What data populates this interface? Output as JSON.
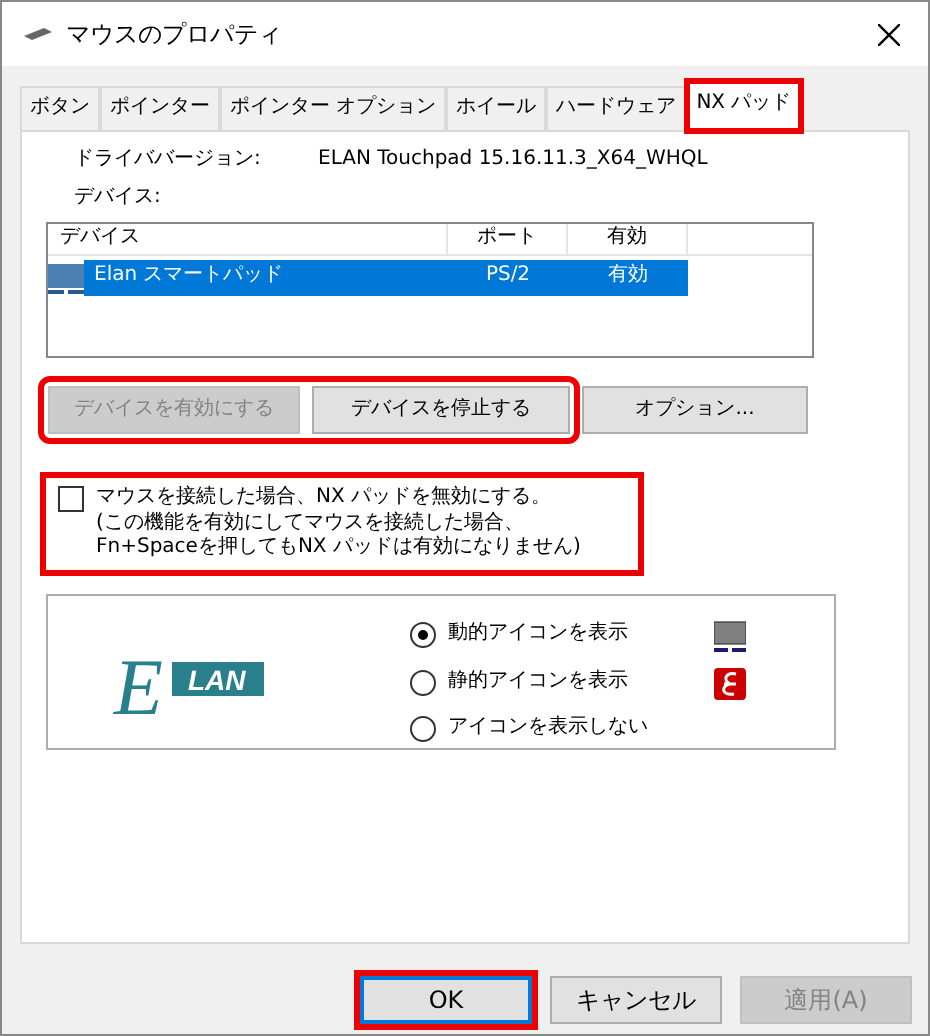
{
  "window": {
    "title": "マウスのプロパティ"
  },
  "tabs": [
    {
      "label": "ボタン",
      "selected": false,
      "highlighted": false
    },
    {
      "label": "ポインター",
      "selected": false,
      "highlighted": false
    },
    {
      "label": "ポインター オプション",
      "selected": false,
      "highlighted": false
    },
    {
      "label": "ホイール",
      "selected": false,
      "highlighted": false
    },
    {
      "label": "ハードウェア",
      "selected": false,
      "highlighted": false
    },
    {
      "label": "NX パッド",
      "selected": true,
      "highlighted": true
    }
  ],
  "driver": {
    "label": "ドライババージョン:",
    "value": "ELAN Touchpad 15.16.11.3_X64_WHQL"
  },
  "devices_label": "デバイス:",
  "device_table": {
    "columns": [
      "デバイス",
      "ポート",
      "有効"
    ],
    "rows": [
      {
        "device": "Elan スマートパッド",
        "port": "PS/2",
        "enabled": "有効",
        "selected": true
      }
    ]
  },
  "device_button_groups": [
    {
      "highlighted": true,
      "buttons": [
        {
          "label": "デバイスを有効にする",
          "disabled": true
        },
        {
          "label": "デバイスを停止する",
          "disabled": false
        }
      ]
    },
    {
      "highlighted": false,
      "buttons": [
        {
          "label": "オプション...",
          "disabled": false
        }
      ]
    }
  ],
  "disable_option": {
    "lines": [
      "マウスを接続した場合、NX パッドを無効にする。",
      "(この機能を有効にしてマウスを接続した場合、",
      "Fn+Spaceを押してもNX パッドは有効になりません)"
    ],
    "checked": false,
    "highlighted": true
  },
  "icon_display": {
    "logo": {
      "letter": "E",
      "text": "LAN"
    },
    "options": [
      {
        "label": "動的アイコンを表示",
        "selected": true,
        "kind": "animated"
      },
      {
        "label": "静的アイコンを表示",
        "selected": false,
        "kind": "static"
      },
      {
        "label": "アイコンを表示しない",
        "selected": false,
        "kind": "none"
      }
    ]
  },
  "buttons": [
    {
      "label": "OK",
      "default": true,
      "highlighted": true,
      "disabled": false
    },
    {
      "label": "キャンセル",
      "default": false,
      "highlighted": false,
      "disabled": false
    },
    {
      "label": "適用(A)",
      "default": false,
      "highlighted": false,
      "disabled": true
    }
  ]
}
